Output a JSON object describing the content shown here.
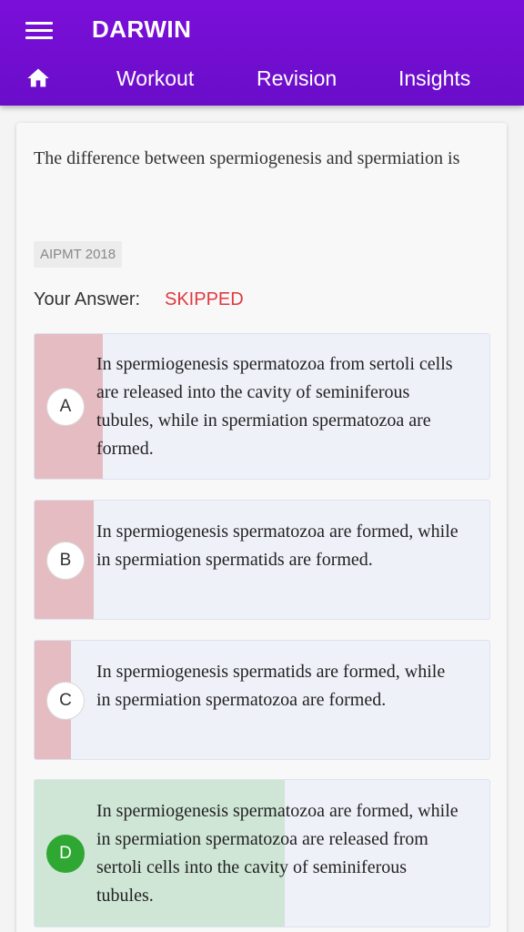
{
  "app": {
    "title": "DARWIN"
  },
  "nav": {
    "tabs": [
      {
        "label": "Workout"
      },
      {
        "label": "Revision"
      },
      {
        "label": "Insights"
      }
    ]
  },
  "question": {
    "text": "The difference between spermiogenesis and spermiation is",
    "tag": "AIPMT 2018",
    "your_answer_label": "Your Answer:",
    "your_answer_value": "SKIPPED"
  },
  "options": [
    {
      "letter": "A",
      "text": "In spermiogenesis spermatozoa from sertoli cells are released into the cavity of seminiferous tubules, while in spermiation spermatozoa are formed.",
      "response_share": 0.15,
      "correct": false
    },
    {
      "letter": "B",
      "text": "In spermiogenesis spermatozoa are formed, while in spermiation spermatids are formed.",
      "response_share": 0.13,
      "correct": false
    },
    {
      "letter": "C",
      "text": "In spermiogenesis spermatids are formed, while in spermiation spermatozoa are formed.",
      "response_share": 0.08,
      "correct": false
    },
    {
      "letter": "D",
      "text": "In spermiogenesis spermatozoa are formed, while in spermiation spermatozoa are released from sertoli cells into the cavity of seminiferous tubules.",
      "response_share": 0.55,
      "correct": true
    }
  ],
  "colors": {
    "header": "#6a0dc9",
    "skipped": "#e0393e",
    "wrong_bar": "#e6bcc3",
    "right_bar": "#cfe5d5",
    "correct_circle": "#2fa833"
  },
  "icons": {
    "menu": "hamburger-icon",
    "home": "home-icon"
  }
}
